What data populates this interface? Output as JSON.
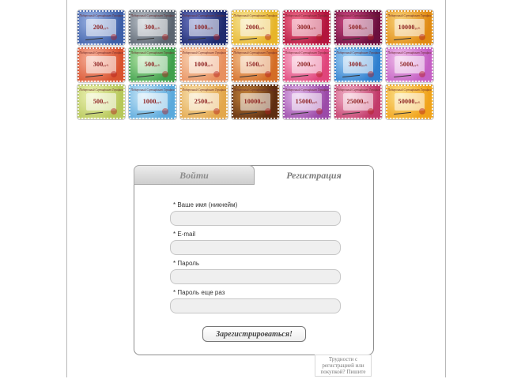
{
  "certificates": {
    "header_text": "Подарочный Сертификат Терафим",
    "currency": "руб.",
    "items": [
      {
        "amount": "200",
        "bg": [
          "#3d5fa8",
          "#9fb6e6"
        ]
      },
      {
        "amount": "300",
        "bg": [
          "#5a6470",
          "#b9c0c8"
        ]
      },
      {
        "amount": "1000",
        "bg": [
          "#1d2a6e",
          "#6e79c4"
        ]
      },
      {
        "amount": "2000",
        "bg": [
          "#e7b52a",
          "#f5e49a"
        ]
      },
      {
        "amount": "3000",
        "bg": [
          "#b3153d",
          "#f0718f"
        ]
      },
      {
        "amount": "5000",
        "bg": [
          "#6b0f3e",
          "#d14b86"
        ]
      },
      {
        "amount": "10000",
        "bg": [
          "#e08a12",
          "#f8d27a"
        ]
      },
      {
        "amount": "300",
        "bg": [
          "#d9532f",
          "#f7b49e"
        ]
      },
      {
        "amount": "500",
        "bg": [
          "#3fa04c",
          "#b4e4a6"
        ]
      },
      {
        "amount": "1000",
        "bg": [
          "#e8905e",
          "#f9d6b8"
        ]
      },
      {
        "amount": "1500",
        "bg": [
          "#d46d26",
          "#f3c393"
        ]
      },
      {
        "amount": "2000",
        "bg": [
          "#e0457b",
          "#f8b6cf"
        ]
      },
      {
        "amount": "3000",
        "bg": [
          "#2f7fcf",
          "#a7d3f4"
        ]
      },
      {
        "amount": "5000",
        "bg": [
          "#c45fc4",
          "#efbde9"
        ]
      },
      {
        "amount": "500",
        "bg": [
          "#b7c85a",
          "#edf2b6"
        ]
      },
      {
        "amount": "1000",
        "bg": [
          "#5aa9dc",
          "#c9e6f7"
        ]
      },
      {
        "amount": "2500",
        "bg": [
          "#e3a74c",
          "#f7e1b1"
        ]
      },
      {
        "amount": "10000",
        "bg": [
          "#5e2d10",
          "#c6853d"
        ]
      },
      {
        "amount": "15000",
        "bg": [
          "#9b4aa8",
          "#e0b7ea"
        ]
      },
      {
        "amount": "25000",
        "bg": [
          "#c23a6a",
          "#f3b7cc"
        ]
      },
      {
        "amount": "50000",
        "bg": [
          "#f0a21a",
          "#fbe08a"
        ]
      }
    ]
  },
  "auth": {
    "tab_login": "Войти",
    "tab_register": "Регистрация",
    "fields": [
      {
        "label": "* Ваше имя (никнейм)",
        "value": ""
      },
      {
        "label": "* E-mail",
        "value": ""
      },
      {
        "label": "* Пароль",
        "value": ""
      },
      {
        "label": "* Пароль еще раз",
        "value": ""
      }
    ],
    "submit_label": "Зарегистрироваться!"
  },
  "help": {
    "text": "Трудности с регистрацией или покупкой? Пишите"
  }
}
